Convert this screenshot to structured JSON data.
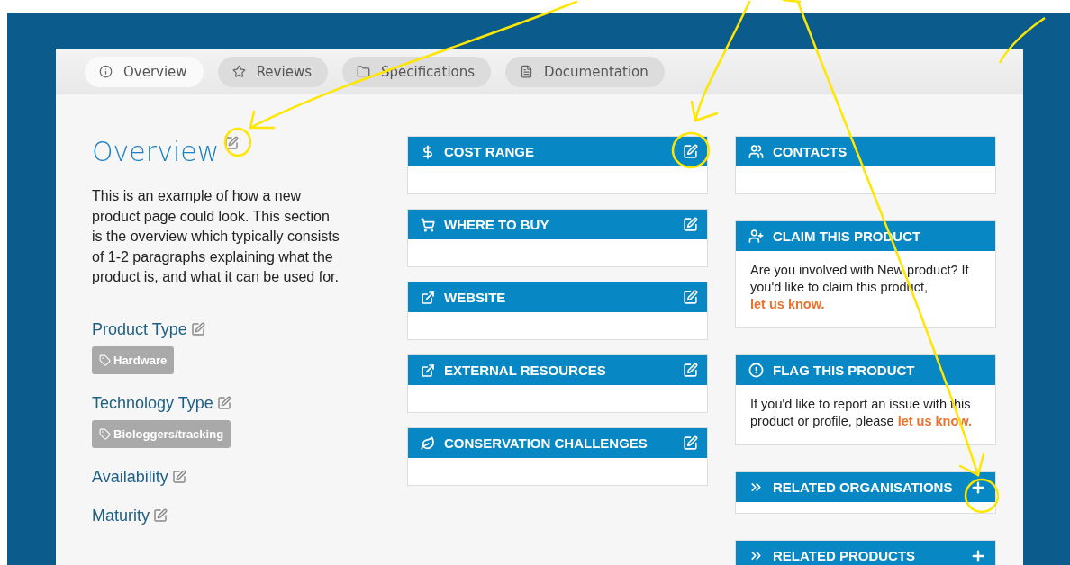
{
  "tabs": [
    {
      "label": "Overview",
      "selected": true
    },
    {
      "label": "Reviews",
      "selected": false
    },
    {
      "label": "Specifications",
      "selected": false
    },
    {
      "label": "Documentation",
      "selected": false
    }
  ],
  "overview": {
    "heading": "Overview",
    "description": "This is an example of how a new product page could look. This section is the overview which typically consists of 1-2 paragraphs explaining what the product is, and what it can be used for.",
    "fields": [
      {
        "label": "Product Type",
        "tags": [
          "Hardware"
        ]
      },
      {
        "label": "Technology Type",
        "tags": [
          "Biologgers/tracking"
        ]
      },
      {
        "label": "Availability"
      },
      {
        "label": "Maturity"
      }
    ]
  },
  "middle_panels": [
    {
      "title": "COST RANGE"
    },
    {
      "title": "WHERE TO BUY"
    },
    {
      "title": "WEBSITE"
    },
    {
      "title": "EXTERNAL RESOURCES"
    },
    {
      "title": "CONSERVATION CHALLENGES"
    }
  ],
  "side_panels": [
    {
      "kind": "empty",
      "title": "CONTACTS"
    },
    {
      "kind": "text",
      "title": "CLAIM THIS PRODUCT",
      "text": "Are you involved with New product? If you'd like to claim this product, ",
      "link": "let us know."
    },
    {
      "kind": "text",
      "title": "FLAG THIS PRODUCT",
      "text": "If you'd like to report an issue with this product or profile, please ",
      "link": "let us know."
    },
    {
      "kind": "collapsible",
      "title": "RELATED ORGANISATIONS"
    },
    {
      "kind": "collapsible",
      "title": "RELATED PRODUCTS"
    }
  ]
}
